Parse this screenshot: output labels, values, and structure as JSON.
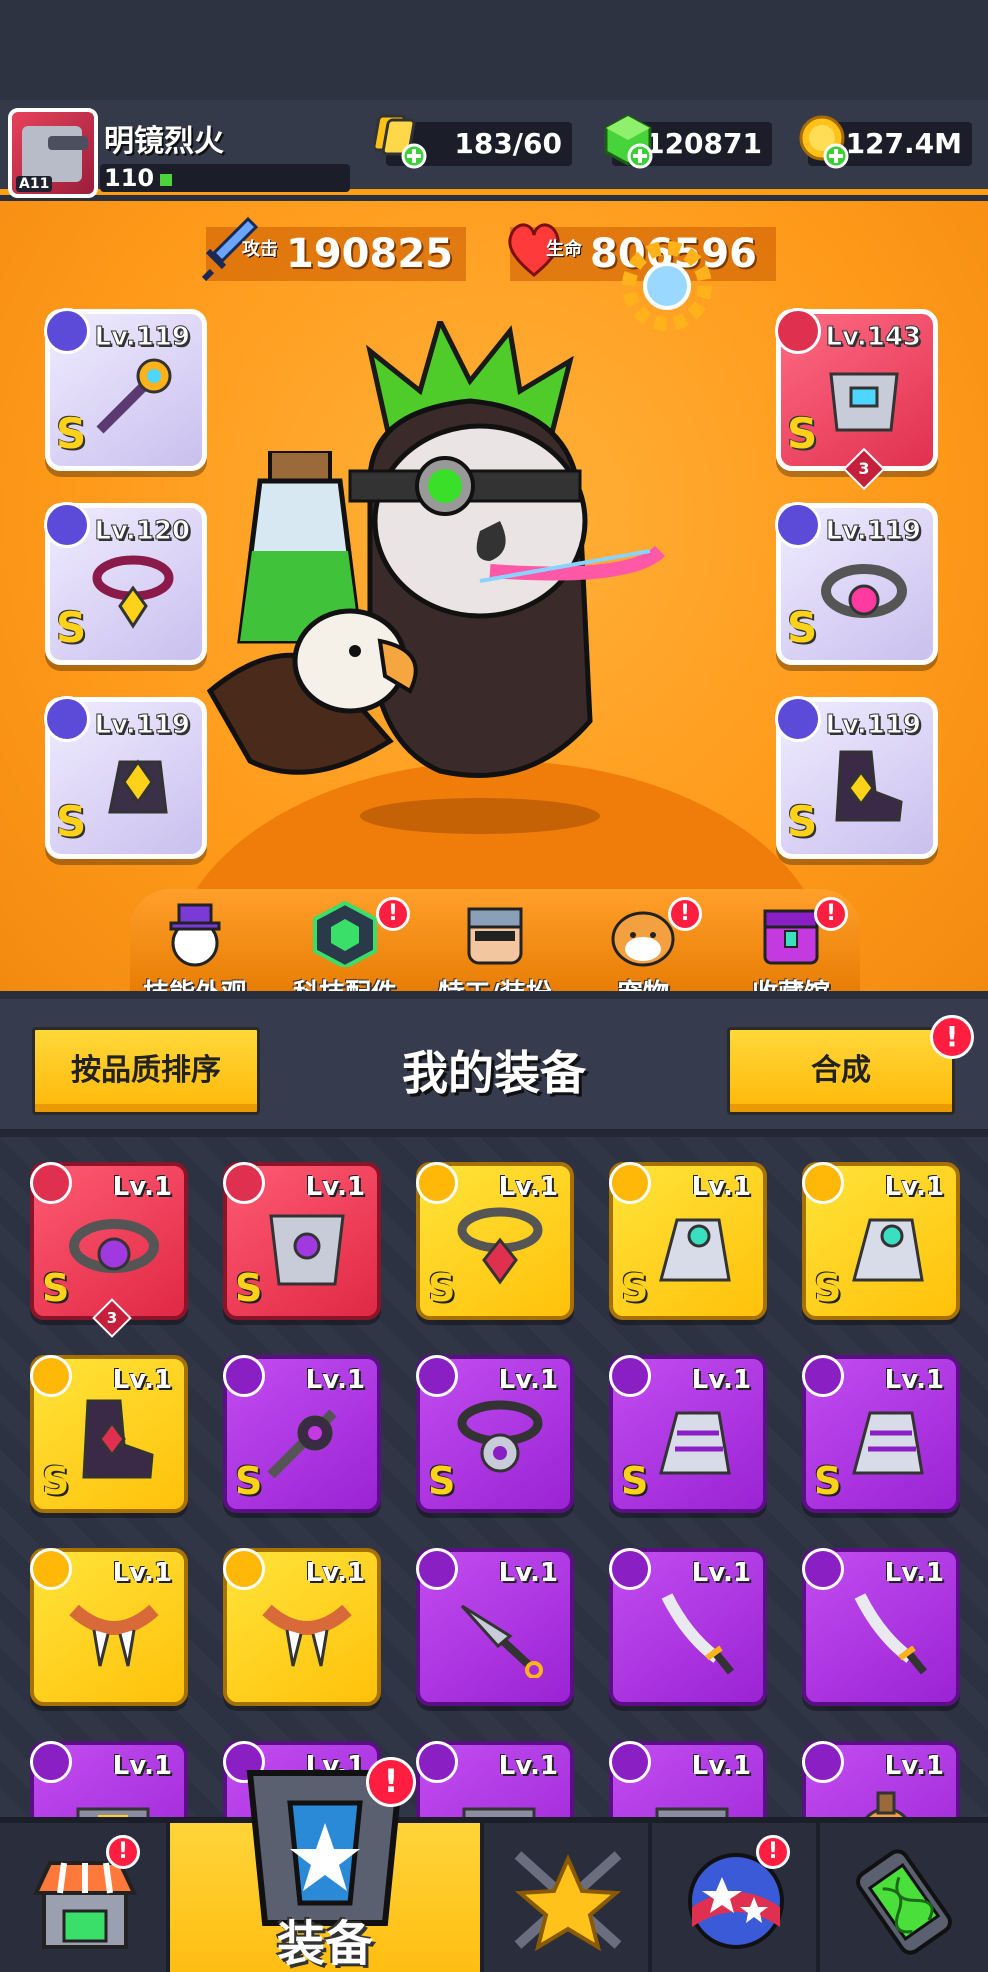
{
  "player": {
    "name": "明镜烈火",
    "level": "110",
    "avatar_tag": "A11"
  },
  "resources": {
    "energy": "183/60",
    "gems": "120871",
    "coins": "127.4M"
  },
  "stats": {
    "attack_label": "攻击",
    "attack_value": "190825",
    "hp_label": "生命",
    "hp_value": "806596"
  },
  "equipped": {
    "left": [
      {
        "level": "Lv.119",
        "grade": "S",
        "icon": "weapon-icon"
      },
      {
        "level": "Lv.120",
        "grade": "S",
        "icon": "necklace-icon"
      },
      {
        "level": "Lv.119",
        "grade": "S",
        "icon": "glove-icon"
      }
    ],
    "right": [
      {
        "level": "Lv.143",
        "grade": "S",
        "icon": "armor-icon",
        "badge": "3"
      },
      {
        "level": "Lv.119",
        "grade": "S",
        "icon": "belt-icon"
      },
      {
        "level": "Lv.119",
        "grade": "S",
        "icon": "boots-icon"
      }
    ]
  },
  "menu": {
    "skin": "技能外观",
    "tech": "科技配件",
    "agent": "特工/装扮",
    "pet": "宠物",
    "collection": "收藏馆",
    "alert_mark": "!"
  },
  "panel": {
    "sort_button": "按品质排序",
    "title": "我的装备",
    "merge_button": "合成"
  },
  "inventory": [
    {
      "level": "Lv.1",
      "grade": "S",
      "rarity": "red",
      "icon": "belt-icon",
      "badge": "3"
    },
    {
      "level": "Lv.1",
      "grade": "S",
      "rarity": "red",
      "icon": "armor-icon"
    },
    {
      "level": "Lv.1",
      "grade": "S",
      "rarity": "gold",
      "icon": "necklace-icon"
    },
    {
      "level": "Lv.1",
      "grade": "S",
      "rarity": "gold",
      "icon": "glove-icon"
    },
    {
      "level": "Lv.1",
      "grade": "S",
      "rarity": "gold",
      "icon": "glove-icon"
    },
    {
      "level": "Lv.1",
      "grade": "S",
      "rarity": "gold",
      "icon": "boots-icon"
    },
    {
      "level": "Lv.1",
      "grade": "S",
      "rarity": "purple",
      "icon": "weapon-icon"
    },
    {
      "level": "Lv.1",
      "grade": "S",
      "rarity": "purple",
      "icon": "necklace-icon"
    },
    {
      "level": "Lv.1",
      "grade": "S",
      "rarity": "purple",
      "icon": "glove-icon"
    },
    {
      "level": "Lv.1",
      "grade": "S",
      "rarity": "purple",
      "icon": "glove-icon"
    },
    {
      "level": "Lv.1",
      "grade": "",
      "rarity": "gold",
      "icon": "necklace-icon"
    },
    {
      "level": "Lv.1",
      "grade": "",
      "rarity": "gold",
      "icon": "necklace-icon"
    },
    {
      "level": "Lv.1",
      "grade": "",
      "rarity": "purple",
      "icon": "kunai-icon"
    },
    {
      "level": "Lv.1",
      "grade": "",
      "rarity": "purple",
      "icon": "sword-icon"
    },
    {
      "level": "Lv.1",
      "grade": "",
      "rarity": "purple",
      "icon": "sword-icon"
    },
    {
      "level": "Lv.1",
      "grade": "",
      "rarity": "purple",
      "icon": "gun-icon"
    },
    {
      "level": "Lv.1",
      "grade": "",
      "rarity": "purple",
      "icon": "weapon-icon"
    },
    {
      "level": "Lv.1",
      "grade": "",
      "rarity": "purple",
      "icon": "gun-icon"
    },
    {
      "level": "Lv.1",
      "grade": "",
      "rarity": "purple",
      "icon": "gun-icon"
    },
    {
      "level": "Lv.1",
      "grade": "",
      "rarity": "purple",
      "icon": "flask-icon"
    }
  ],
  "bottom_nav": {
    "equipment_label": "装备",
    "alert_mark": "!"
  },
  "colors": {
    "orange": "#ff9e10",
    "red_rarity": "#e0304f",
    "gold_rarity": "#ffc10a",
    "purple_rarity": "#9a23d4"
  }
}
